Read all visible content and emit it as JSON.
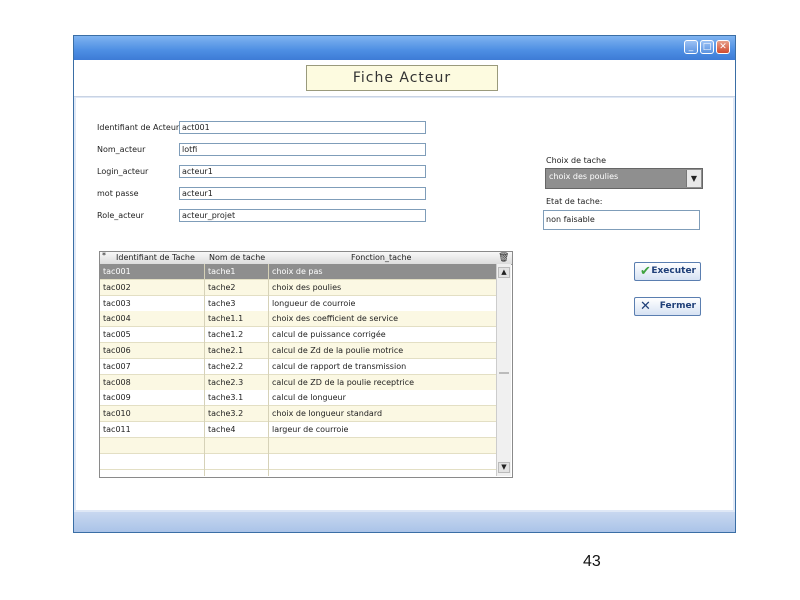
{
  "window": {
    "controls": {
      "minimize": "_",
      "maximize": "□",
      "close": "✕"
    }
  },
  "header": {
    "title": "Fiche  Acteur"
  },
  "form": {
    "fields": [
      {
        "label": "Identifiant de Acteur",
        "value": "act001"
      },
      {
        "label": "Nom_acteur",
        "value": "lotfi"
      },
      {
        "label": "Login_acteur",
        "value": "acteur1"
      },
      {
        "label": "mot passe",
        "value": "acteur1"
      },
      {
        "label": "Role_acteur",
        "value": "acteur_projet"
      }
    ]
  },
  "task_choice": {
    "label": "Choix de tache",
    "selected": "choix des poulies",
    "arrow": "▼"
  },
  "task_state": {
    "label": "Etat de tache:",
    "value": "non faisable"
  },
  "grid": {
    "headers": {
      "row_marker": "*",
      "id": "Identifiant de Tache",
      "name": "Nom de tache",
      "function": "Fonction_tache"
    },
    "rows": [
      {
        "id": "tac001",
        "name": "tache1",
        "function": "choix de pas"
      },
      {
        "id": "tac002",
        "name": "tache2",
        "function": "choix des poulies"
      },
      {
        "id": "tac003",
        "name": "tache3",
        "function": "longueur de courroie"
      },
      {
        "id": "tac004",
        "name": "tache1.1",
        "function": "choix des coefficient de service"
      },
      {
        "id": "tac005",
        "name": "tache1.2",
        "function": "calcul de puissance corrigée"
      },
      {
        "id": "tac006",
        "name": "tache2.1",
        "function": "calcul de Zd de la poulie motrice"
      },
      {
        "id": "tac007",
        "name": "tache2.2",
        "function": "calcul de rapport de transmission"
      },
      {
        "id": "tac008",
        "name": "tache2.3",
        "function": "calcul de ZD de la poulie receptrice"
      },
      {
        "id": "tac009",
        "name": "tache3.1",
        "function": "calcul de longueur"
      },
      {
        "id": "tac010",
        "name": "tache3.2",
        "function": "choix de longueur standard"
      },
      {
        "id": "tac011",
        "name": "tache4",
        "function": "largeur de courroie"
      }
    ],
    "scroll_up": "▲",
    "scroll_down": "▼"
  },
  "buttons": {
    "execute": {
      "icon": "check-icon",
      "label": "Executer",
      "glyph": "✔",
      "color": "#3fa33f"
    },
    "close": {
      "icon": "x-icon",
      "label": "Fermer",
      "glyph": "✕",
      "color": "#1f3f78"
    }
  },
  "page_number": "43",
  "colors": {
    "selected_row": "#8e8e8e",
    "row_alt": "#fbf8e3",
    "titlebar": "#4d8ee3"
  }
}
